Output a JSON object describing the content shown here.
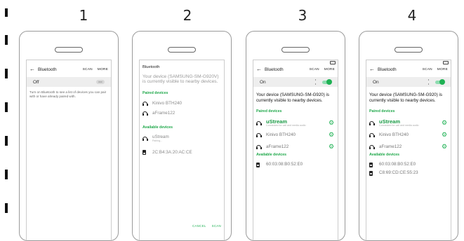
{
  "steps": [
    "1",
    "2",
    "3",
    "4"
  ],
  "phone1": {
    "title": "Bluetooth",
    "scan": "SCAN",
    "more": "MORE",
    "toggle_label": "Off",
    "toggle_state": "OFF",
    "hint": "Turn on Bluetooth to see a list of devices you can pair with or have already paired with."
  },
  "phone2": {
    "dialog_title": "Bluetooth",
    "visibility_text": "Your device (SAMSUNG-SM-G920V) is currently visible to nearby devices.",
    "paired_header": "Paired devices",
    "paired": [
      {
        "name": "Kinivo BTH240",
        "icon": "headphones-icon"
      },
      {
        "name": "aFrame122",
        "icon": "headphones-icon"
      }
    ],
    "available_header": "Available devices",
    "available": [
      {
        "name": "uStream",
        "sub": "Pairing...",
        "icon": "headphones-icon"
      },
      {
        "name": "2C:B4:3A:20:AC:CE",
        "icon": "speaker-icon"
      }
    ],
    "cancel": "CANCEL",
    "scan": "SCAN"
  },
  "phone3": {
    "title": "Bluetooth",
    "scan": "SCAN",
    "more": "MORE",
    "toggle_label": "On",
    "visibility_text": "Your device (SAMSUNG-SM-G920) is currently visible to nearby devices.",
    "paired_header": "Paired devices",
    "paired": [
      {
        "name": "uStream",
        "sub": "Connected for call and media audio",
        "icon": "headphones-icon",
        "highlight": true
      },
      {
        "name": "Kinivo BTH240",
        "icon": "headphones-icon"
      },
      {
        "name": "aFrame122",
        "icon": "headphones-icon"
      }
    ],
    "available_header": "Available devices",
    "available": [
      {
        "name": "60:03:08:B0:52:E0",
        "icon": "speaker-icon"
      }
    ]
  },
  "phone4": {
    "title": "Bluetooth",
    "scan": "SCAN",
    "more": "MORE",
    "toggle_label": "On",
    "visibility_text": "Your device (SAMSUNG-SM-G920) is currently visible to nearby devices.",
    "paired_header": "Paired devices",
    "paired": [
      {
        "name": "uStream",
        "sub": "Connected for call and media audio",
        "icon": "headphones-icon",
        "highlight": true
      },
      {
        "name": "Kinivo BTH240",
        "icon": "headphones-icon"
      },
      {
        "name": "aFrame122",
        "icon": "headphones-icon"
      }
    ],
    "available_header": "Available devices",
    "available": [
      {
        "name": "60:03:08:B0:52:E0",
        "icon": "speaker-icon"
      },
      {
        "name": "C8:69:CD:CE:55:23",
        "icon": "speaker-icon"
      }
    ]
  },
  "colors": {
    "accent": "#1fb154",
    "section": "#1fa84a",
    "ustream": "#1a9a45"
  }
}
